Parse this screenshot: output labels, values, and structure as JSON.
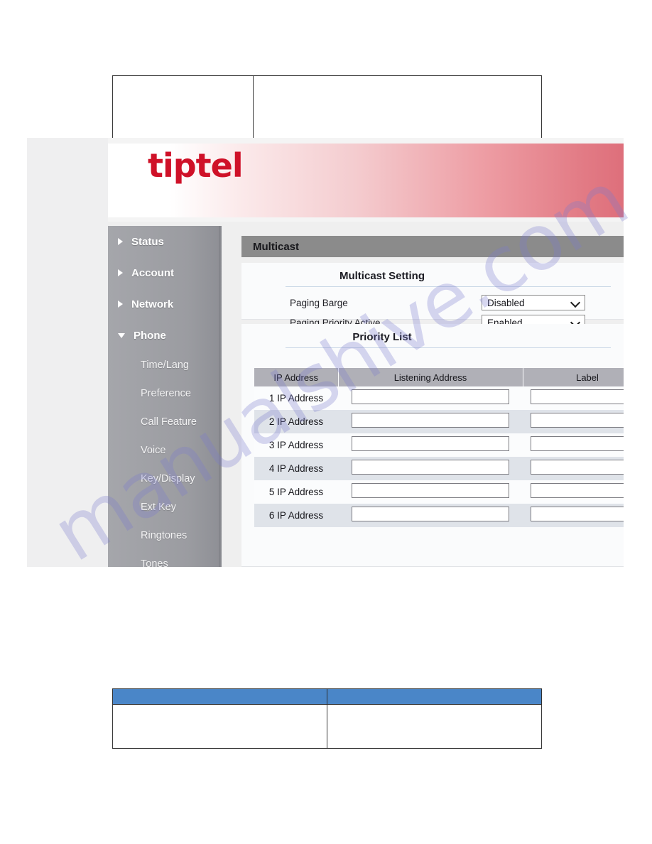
{
  "document": {
    "top_table": {
      "rows": [
        {
          "cells": [
            "",
            ""
          ]
        }
      ]
    },
    "bottom_table": {
      "header_color": "#4a86c8",
      "header_cells": [
        "",
        ""
      ],
      "rows": [
        {
          "cells": [
            "",
            ""
          ]
        }
      ]
    }
  },
  "watermark": {
    "text": "manualshive.com",
    "color": "#7a7acc"
  },
  "screenshot": {
    "brand": {
      "logo_text": "tiptel",
      "logo_color": "#cf1128"
    },
    "sidebar": {
      "top_items": [
        {
          "label": "Status",
          "icon": "triangle-right-icon",
          "expanded": false
        },
        {
          "label": "Account",
          "icon": "triangle-right-icon",
          "expanded": false
        },
        {
          "label": "Network",
          "icon": "triangle-right-icon",
          "expanded": false
        },
        {
          "label": "Phone",
          "icon": "triangle-down-icon",
          "expanded": true
        }
      ],
      "sub_items": [
        {
          "label": "Time/Lang"
        },
        {
          "label": "Preference"
        },
        {
          "label": "Call Feature"
        },
        {
          "label": "Voice"
        },
        {
          "label": "Key/Display"
        },
        {
          "label": "Ext Key"
        },
        {
          "label": "Ringtones"
        },
        {
          "label": "Tones"
        }
      ]
    },
    "main": {
      "title": "Multicast",
      "multicast_setting": {
        "heading": "Multicast Setting",
        "fields": [
          {
            "label": "Paging Barge",
            "value": "Disabled"
          },
          {
            "label": "Paging Priority Active",
            "value": "Enabled"
          }
        ]
      },
      "priority_list": {
        "heading": "Priority List",
        "columns": [
          "IP Address",
          "Listening Address",
          "Label"
        ],
        "rows": [
          {
            "ip": "1 IP Address",
            "listening": "",
            "label": ""
          },
          {
            "ip": "2 IP Address",
            "listening": "",
            "label": ""
          },
          {
            "ip": "3 IP Address",
            "listening": "",
            "label": ""
          },
          {
            "ip": "4 IP Address",
            "listening": "",
            "label": ""
          },
          {
            "ip": "5 IP Address",
            "listening": "",
            "label": ""
          },
          {
            "ip": "6 IP Address",
            "listening": "",
            "label": ""
          }
        ]
      }
    }
  }
}
